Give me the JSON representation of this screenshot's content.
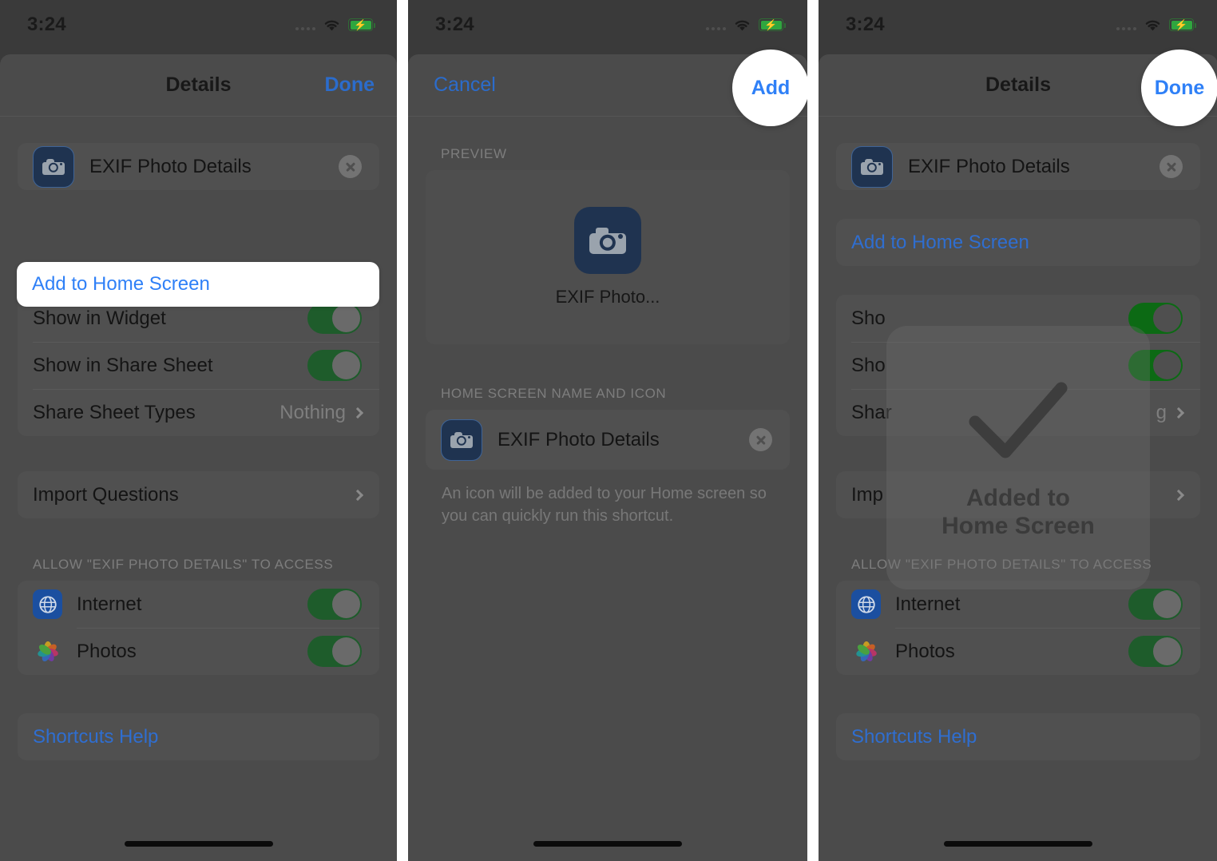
{
  "statusbar": {
    "time": "3:24"
  },
  "panel1": {
    "nav": {
      "title": "Details",
      "right": "Done"
    },
    "shortcut_row": {
      "name": "EXIF Photo Details"
    },
    "add_home_screen": "Add to Home Screen",
    "settings_rows": [
      {
        "label": "Show in Widget",
        "type": "toggle",
        "value": "on"
      },
      {
        "label": "Show in Share Sheet",
        "type": "toggle",
        "value": "on"
      },
      {
        "label": "Share Sheet Types",
        "type": "value",
        "value": "Nothing"
      }
    ],
    "import_questions": "Import Questions",
    "access_header": "ALLOW \"EXIF PHOTO DETAILS\" TO ACCESS",
    "access_rows": [
      {
        "label": "Internet",
        "icon": "globe-icon",
        "value": "on"
      },
      {
        "label": "Photos",
        "icon": "photos-icon",
        "value": "on"
      }
    ],
    "help_link": "Shortcuts Help"
  },
  "panel2": {
    "nav": {
      "left": "Cancel",
      "right": "Add"
    },
    "preview_header": "PREVIEW",
    "preview_label": "EXIF Photo...",
    "name_icon_header": "HOME SCREEN NAME AND ICON",
    "name_value": "EXIF Photo Details",
    "footnote": "An icon will be added to your Home screen so you can quickly run this shortcut."
  },
  "panel3": {
    "nav": {
      "title": "Details",
      "right": "Done"
    },
    "shortcut_row": {
      "name": "EXIF Photo Details"
    },
    "add_home_screen": "Add to Home Screen",
    "settings_rows": [
      {
        "label": "Sho",
        "type": "toggle",
        "value": "on"
      },
      {
        "label": "Sho",
        "type": "toggle",
        "value": "on"
      },
      {
        "label": "Shar",
        "type": "value",
        "value": "g"
      }
    ],
    "import_questions": "Imp",
    "access_header": "ALLOW \"EXIF PHOTO DETAILS\" TO ACCESS",
    "access_rows": [
      {
        "label": "Internet",
        "icon": "globe-icon",
        "value": "on"
      },
      {
        "label": "Photos",
        "icon": "photos-icon",
        "value": "on"
      }
    ],
    "help_link": "Shortcuts Help",
    "hud": {
      "line1": "Added to",
      "line2": "Home Screen",
      "icon": "checkmark-icon"
    }
  },
  "colors": {
    "accent_blue": "#2f80f7",
    "link_blue": "#2b6ccc",
    "toggle_green": "#1e5c2b",
    "sheet_bg": "#4b4b4b",
    "group_bg": "#505050",
    "icon_navy": "#1f3350"
  }
}
